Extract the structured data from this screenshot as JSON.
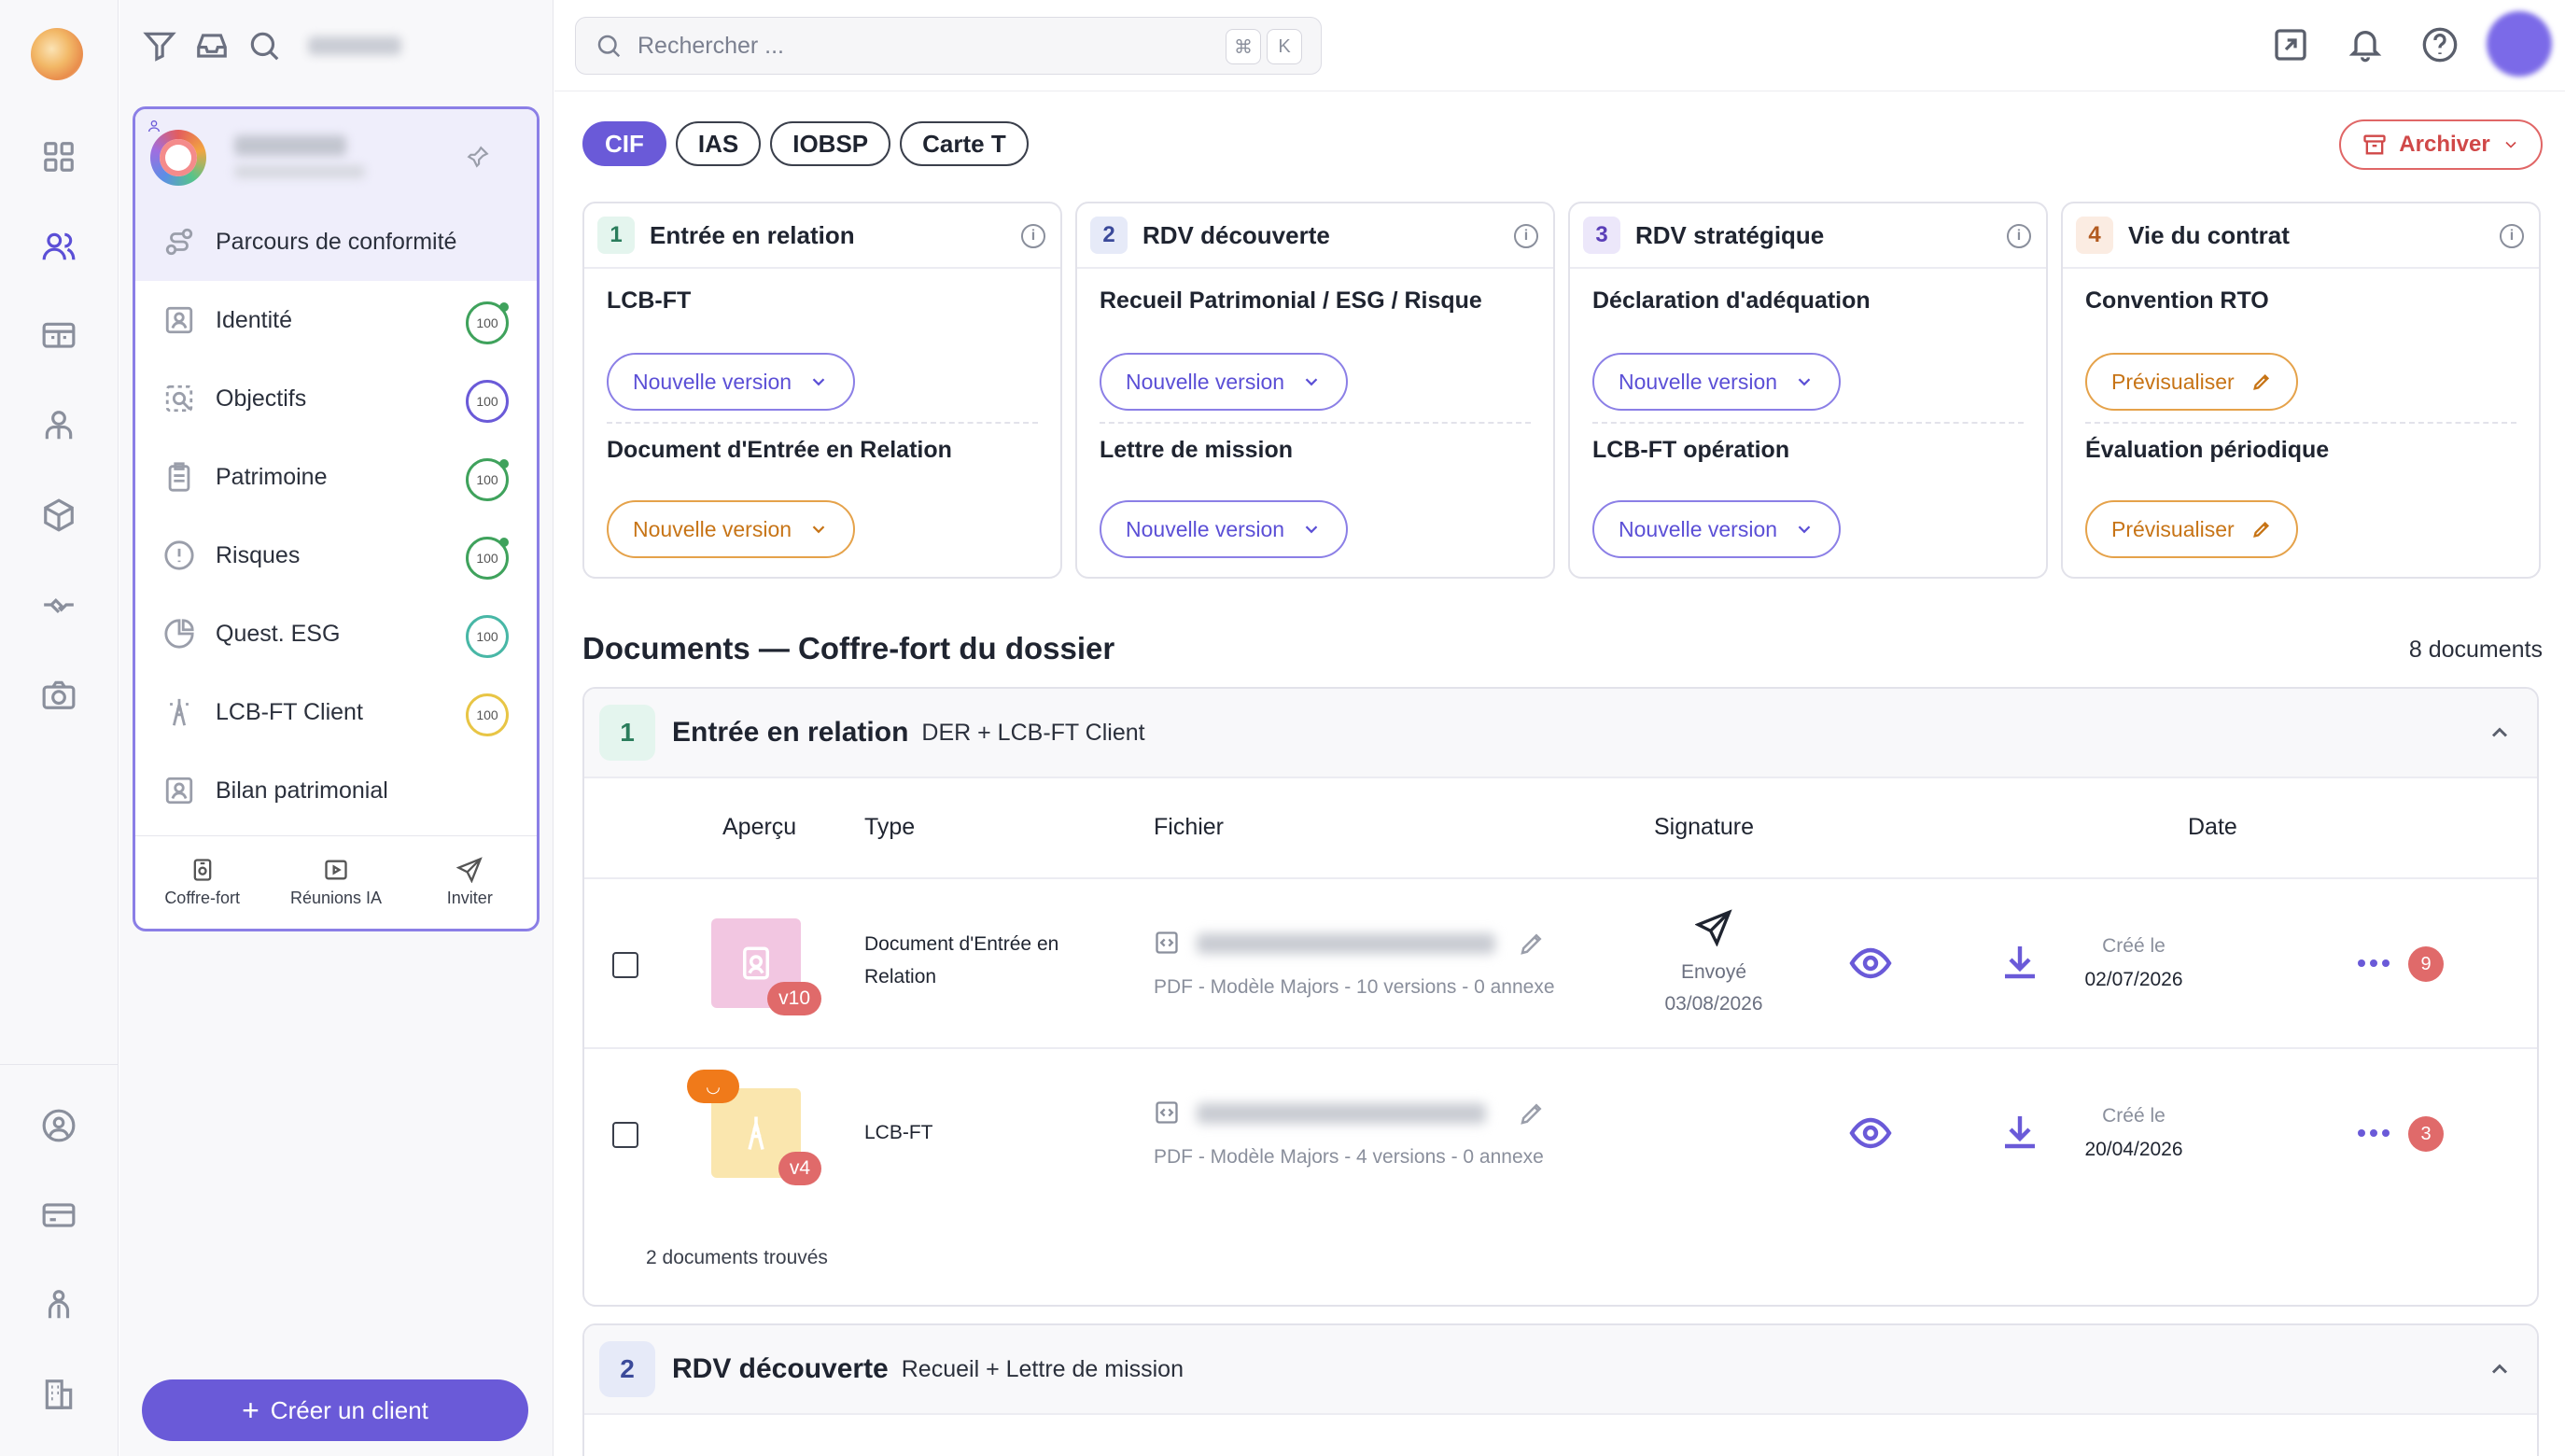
{
  "rail": {
    "icons": [
      "app-logo",
      "dashboard-icon",
      "clients-icon",
      "board-icon",
      "advisor-icon",
      "products-icon",
      "handshake-icon",
      "camera-icon"
    ],
    "bottom_icons": [
      "profile-icon",
      "billing-icon",
      "team-icon",
      "building-icon"
    ]
  },
  "client_panel": {
    "menu": [
      {
        "label": "Parcours de conformité",
        "icon": "route-icon",
        "score": null
      },
      {
        "label": "Identité",
        "icon": "id-card-icon",
        "score": "100"
      },
      {
        "label": "Objectifs",
        "icon": "target-icon",
        "score": "100"
      },
      {
        "label": "Patrimoine",
        "icon": "clipboard-icon",
        "score": "100"
      },
      {
        "label": "Risques",
        "icon": "alert-icon",
        "score": "100"
      },
      {
        "label": "Quest. ESG",
        "icon": "pie-icon",
        "score": "100"
      },
      {
        "label": "LCB-FT Client",
        "icon": "tower-icon",
        "score": "100"
      },
      {
        "label": "Bilan patrimonial",
        "icon": "report-icon",
        "score": null
      }
    ],
    "footer": [
      {
        "label": "Coffre-fort",
        "icon": "safe-icon"
      },
      {
        "label": "Réunions IA",
        "icon": "video-icon"
      },
      {
        "label": "Inviter",
        "icon": "send-icon"
      }
    ],
    "create_button": "Créer un client"
  },
  "topbar": {
    "search_placeholder": "Rechercher ...",
    "kbd1": "⌘",
    "kbd2": "K"
  },
  "pills": [
    "CIF",
    "IAS",
    "IOBSP",
    "Carte T"
  ],
  "archive_label": "Archiver",
  "steps": [
    {
      "num": "1",
      "title": "Entrée en relation",
      "sections": [
        {
          "title": "LCB-FT",
          "button": "Nouvelle version"
        },
        {
          "title": "Document d'Entrée en Relation",
          "button": "Nouvelle version"
        }
      ]
    },
    {
      "num": "2",
      "title": "RDV découverte",
      "sections": [
        {
          "title": "Recueil Patrimonial / ESG / Risque",
          "button": "Nouvelle version"
        },
        {
          "title": "Lettre de mission",
          "button": "Nouvelle version"
        }
      ]
    },
    {
      "num": "3",
      "title": "RDV stratégique",
      "sections": [
        {
          "title": "Déclaration d'adéquation",
          "button": "Nouvelle version"
        },
        {
          "title": "LCB-FT opération",
          "button": "Nouvelle version"
        }
      ]
    },
    {
      "num": "4",
      "title": "Vie du contrat",
      "sections": [
        {
          "title": "Convention RTO",
          "button": "Prévisualiser"
        },
        {
          "title": "Évaluation périodique",
          "button": "Prévisualiser"
        }
      ]
    }
  ],
  "docs": {
    "title": "Documents — Coffre-fort du dossier",
    "count": "8 documents",
    "columns": [
      "Aperçu",
      "Type",
      "Fichier",
      "Signature",
      "Date"
    ],
    "groups": [
      {
        "num": "1",
        "title": "Entrée en relation",
        "sub": "DER + LCB-FT Client",
        "rows": [
          {
            "type1": "Document d'Entrée en",
            "type2": "Relation",
            "version": "v10",
            "meta": "PDF - Modèle Majors - 10 versions - 0 annexe",
            "sig_status": "Envoyé",
            "sig_date": "03/08/2026",
            "date_label": "Créé le",
            "date": "02/07/2026",
            "count": "9"
          },
          {
            "type1": "LCB-FT",
            "type2": "",
            "version": "v4",
            "meta": "PDF - Modèle Majors - 4 versions - 0 annexe",
            "sig_status": "",
            "sig_date": "",
            "date_label": "Créé le",
            "date": "20/04/2026",
            "count": "3"
          }
        ],
        "found": "2 documents trouvés"
      },
      {
        "num": "2",
        "title": "RDV découverte",
        "sub": "Recueil + Lettre de mission"
      }
    ]
  }
}
